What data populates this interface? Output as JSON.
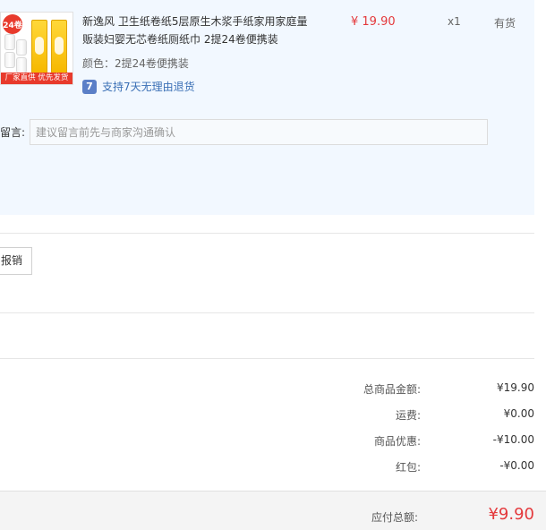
{
  "product": {
    "image_banner": "厂家直供 优先发货",
    "image_badge": "24卷",
    "title": "新逸风 卫生纸卷纸5层原生木浆手纸家用家庭量贩装妇婴无芯卷纸厕纸巾 2提24卷便携装",
    "spec_label": "颜色：",
    "spec_value": "2提24卷便携装",
    "guarantee_icon": "7",
    "guarantee_text": "支持7天无理由退货",
    "price": "¥ 19.90",
    "quantity": "x1",
    "stock": "有货"
  },
  "remark": {
    "label": "留言:",
    "placeholder": "建议留言前先与商家沟通确认",
    "value": ""
  },
  "invoice": {
    "button_label": "报销"
  },
  "summary": {
    "rows": [
      {
        "label": "总商品金额:",
        "value": "¥19.90"
      },
      {
        "label": "运费:",
        "value": "¥0.00"
      },
      {
        "label": "商品优惠:",
        "value": "-¥10.00"
      },
      {
        "label": "红包:",
        "value": "-¥0.00"
      }
    ],
    "total_label": "应付总额:",
    "total_value": "¥9.90"
  },
  "colors": {
    "accent_red": "#e4393c",
    "panel_bg": "#f2f8ff",
    "link_blue": "#3a6fb5"
  },
  "icons": {
    "return_policy": "return-7-days-icon"
  }
}
